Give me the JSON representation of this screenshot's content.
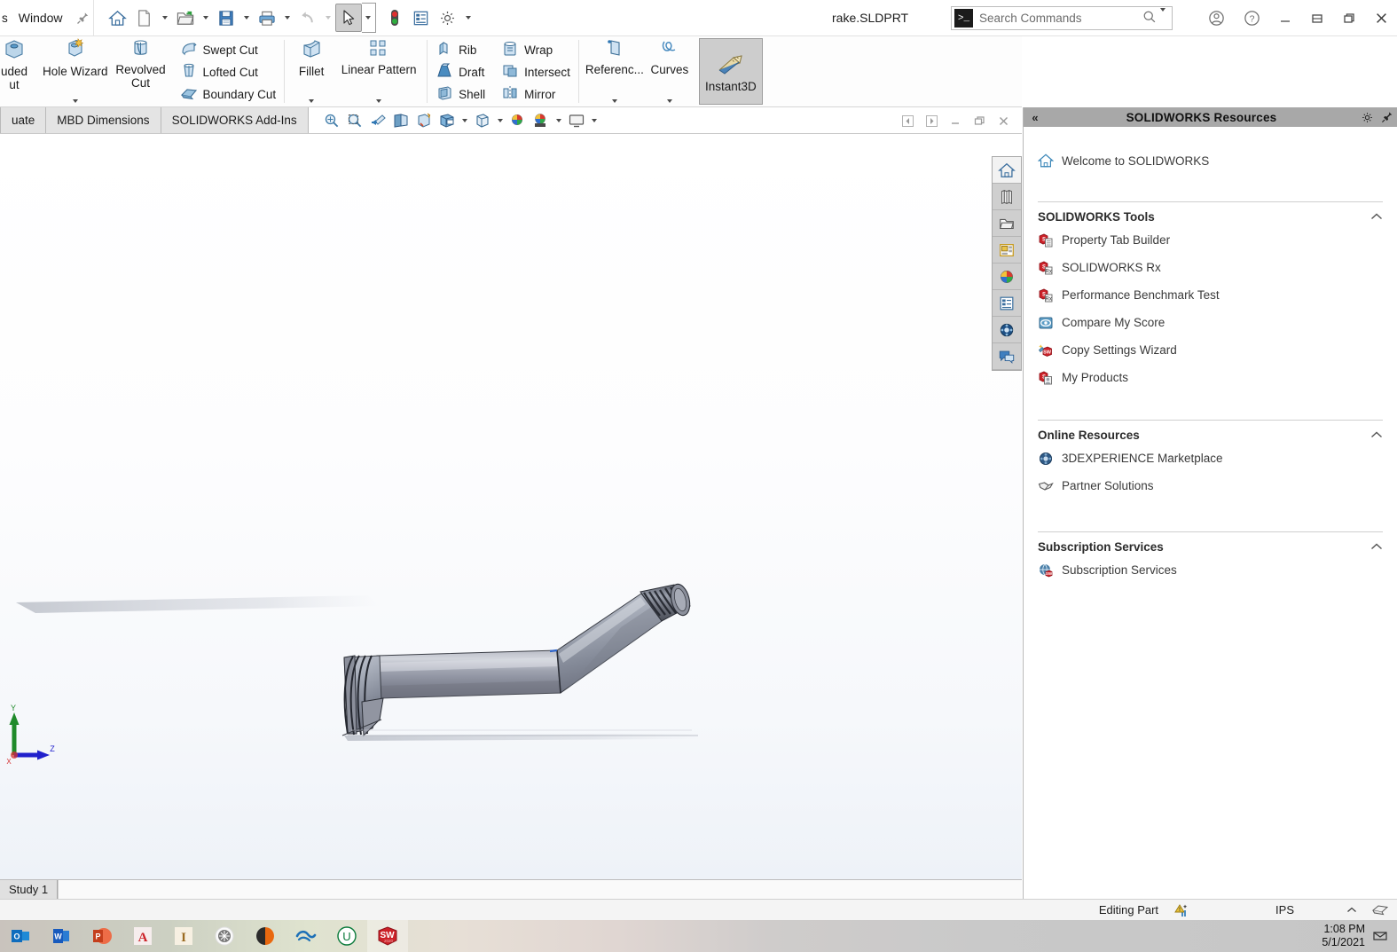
{
  "window": {
    "document_title": "rake.SLDPRT",
    "menu_partial": "s",
    "menu_window": "Window",
    "pin_icon": "pin-icon"
  },
  "search": {
    "placeholder": "Search Commands",
    "command_icon": "command-prompt-icon",
    "magnifier_icon": "search-icon",
    "dropdown_icon": "chevron-down-icon"
  },
  "titlebar_buttons": {
    "account": "account-icon",
    "help": "help-icon",
    "minimize": "minimize-icon",
    "restore": "restore-icon",
    "maximize": "maximize-icon",
    "close": "close-icon"
  },
  "quick_access": [
    {
      "name": "home-icon",
      "label": "Home",
      "has_dropdown": false
    },
    {
      "name": "new-document-icon",
      "label": "New",
      "has_dropdown": true
    },
    {
      "name": "open-folder-icon",
      "label": "Open",
      "has_dropdown": true
    },
    {
      "name": "save-icon",
      "label": "Save",
      "has_dropdown": true
    },
    {
      "name": "print-icon",
      "label": "Print",
      "has_dropdown": true
    },
    {
      "name": "undo-icon",
      "label": "Undo",
      "has_dropdown": true
    },
    {
      "name": "select-cursor-icon",
      "label": "Select",
      "has_dropdown": true
    },
    {
      "name": "rebuild-icon",
      "label": "Rebuild",
      "has_dropdown": false
    },
    {
      "name": "file-properties-icon",
      "label": "File Properties",
      "has_dropdown": false
    },
    {
      "name": "options-gear-icon",
      "label": "Options",
      "has_dropdown": true
    }
  ],
  "ribbon": {
    "groups": [
      {
        "type": "big",
        "items": [
          {
            "label": "uded\nut",
            "icon": "extruded-cut-icon",
            "dropdown": false
          },
          {
            "label": "Hole Wizard",
            "icon": "hole-wizard-icon",
            "dropdown": true
          },
          {
            "label": "Revolved\nCut",
            "icon": "revolved-cut-icon",
            "dropdown": false
          }
        ]
      },
      {
        "type": "small",
        "items": [
          {
            "label": "Swept Cut",
            "icon": "swept-cut-icon"
          },
          {
            "label": "Lofted Cut",
            "icon": "lofted-cut-icon"
          },
          {
            "label": "Boundary Cut",
            "icon": "boundary-cut-icon"
          }
        ]
      },
      {
        "type": "big",
        "items": [
          {
            "label": "Fillet",
            "icon": "fillet-icon",
            "dropdown": true
          },
          {
            "label": "Linear Pattern",
            "icon": "linear-pattern-icon",
            "dropdown": true
          }
        ]
      },
      {
        "type": "small",
        "items": [
          {
            "label": "Rib",
            "icon": "rib-icon"
          },
          {
            "label": "Draft",
            "icon": "draft-icon"
          },
          {
            "label": "Shell",
            "icon": "shell-icon"
          }
        ]
      },
      {
        "type": "small",
        "items": [
          {
            "label": "Wrap",
            "icon": "wrap-icon"
          },
          {
            "label": "Intersect",
            "icon": "intersect-icon"
          },
          {
            "label": "Mirror",
            "icon": "mirror-icon"
          }
        ]
      },
      {
        "type": "big",
        "items": [
          {
            "label": "Referenc...",
            "icon": "reference-geometry-icon",
            "dropdown": true
          },
          {
            "label": "Curves",
            "icon": "curves-icon",
            "dropdown": true
          }
        ]
      }
    ],
    "instant3d": {
      "label": "Instant3D",
      "icon": "instant3d-icon",
      "selected": true
    }
  },
  "command_tabs": [
    {
      "label": "uate",
      "active": false
    },
    {
      "label": "MBD Dimensions",
      "active": false
    },
    {
      "label": "SOLIDWORKS Add-Ins",
      "active": false
    }
  ],
  "view_tools": [
    {
      "name": "zoom-to-fit-icon",
      "label": "Zoom to Fit",
      "dropdown": false
    },
    {
      "name": "zoom-to-area-icon",
      "label": "Zoom to Area",
      "dropdown": false
    },
    {
      "name": "previous-view-icon",
      "label": "Previous View",
      "dropdown": false
    },
    {
      "name": "section-view-icon",
      "label": "Section View",
      "dropdown": false
    },
    {
      "name": "view-orientation-icon",
      "label": "View Orientation",
      "dropdown": false
    },
    {
      "name": "display-style-icon",
      "label": "Display Style",
      "dropdown": true
    },
    {
      "name": "hide-show-items-icon",
      "label": "Hide/Show Items",
      "dropdown": true
    },
    {
      "name": "edit-appearance-icon",
      "label": "Edit Appearance",
      "dropdown": true
    },
    {
      "name": "apply-scene-icon",
      "label": "Apply Scene",
      "dropdown": true
    },
    {
      "name": "view-settings-icon",
      "label": "View Settings",
      "dropdown": true
    }
  ],
  "viewport_window_controls": [
    {
      "name": "prev-pane-icon",
      "label": "Previous"
    },
    {
      "name": "next-pane-icon",
      "label": "Next"
    },
    {
      "name": "minimize-window-icon",
      "label": "Minimize"
    },
    {
      "name": "restore-window-icon",
      "label": "Restore"
    },
    {
      "name": "close-window-icon",
      "label": "Close"
    }
  ],
  "viewport_sidebar": [
    {
      "name": "solidworks-resources-icon",
      "label": "SOLIDWORKS Resources",
      "active": true
    },
    {
      "name": "design-library-icon",
      "label": "Design Library",
      "active": false
    },
    {
      "name": "file-explorer-icon",
      "label": "File Explorer",
      "active": false
    },
    {
      "name": "view-palette-icon",
      "label": "View Palette",
      "active": false
    },
    {
      "name": "appearances-scenes-icon",
      "label": "Appearances, Scenes and Decals",
      "active": false
    },
    {
      "name": "custom-properties-icon",
      "label": "Custom Properties",
      "active": false
    },
    {
      "name": "3dexperience-marketplace-icon",
      "label": "3DEXPERIENCE Marketplace",
      "active": false
    },
    {
      "name": "solidworks-forum-icon",
      "label": "SOLIDWORKS Forum",
      "active": false
    }
  ],
  "triad": {
    "x_label": "X",
    "y_label": "Y",
    "z_label": "Z",
    "x_color": "#d43030",
    "y_color": "#1f8a2a",
    "z_color": "#2020cc"
  },
  "study_bar": {
    "tab_label": "Study 1"
  },
  "task_pane": {
    "title": "SOLIDWORKS Resources",
    "collapse_icon": "chevron-double-left-icon",
    "gear_icon": "gear-icon",
    "pin_icon": "pin-icon",
    "welcome": {
      "label": "Welcome to SOLIDWORKS",
      "icon": "home-icon"
    },
    "sections": [
      {
        "title": "SOLIDWORKS Tools",
        "chevron": "chevron-up-icon",
        "links": [
          {
            "label": "Property Tab Builder",
            "icon": "sw-property-tab-icon"
          },
          {
            "label": "SOLIDWORKS Rx",
            "icon": "sw-rx-icon"
          },
          {
            "label": "Performance Benchmark Test",
            "icon": "sw-benchmark-icon"
          },
          {
            "label": "Compare My Score",
            "icon": "compare-score-icon"
          },
          {
            "label": "Copy Settings Wizard",
            "icon": "copy-settings-icon"
          },
          {
            "label": "My Products",
            "icon": "my-products-icon"
          }
        ]
      },
      {
        "title": "Online Resources",
        "chevron": "chevron-up-icon",
        "links": [
          {
            "label": "3DEXPERIENCE Marketplace",
            "icon": "3dexperience-icon"
          },
          {
            "label": "Partner Solutions",
            "icon": "partner-solutions-icon"
          }
        ]
      },
      {
        "title": "Subscription Services",
        "chevron": "chevron-up-icon",
        "links": [
          {
            "label": "Subscription Services",
            "icon": "subscription-globe-icon"
          }
        ]
      }
    ]
  },
  "status_bar": {
    "editing_state": "Editing Part",
    "units": "IPS",
    "overlay_icon": "overdefined-warning-icon",
    "units_caret": "chevron-up-icon",
    "tile_icon": "tile-windows-icon"
  },
  "taskbar": {
    "apps": [
      {
        "name": "outlook-icon",
        "label": "Outlook",
        "active": false
      },
      {
        "name": "word-icon",
        "label": "Word",
        "active": false
      },
      {
        "name": "powerpoint-icon",
        "label": "PowerPoint",
        "active": false
      },
      {
        "name": "autodesk-icon",
        "label": "Autodesk",
        "active": false
      },
      {
        "name": "inventor-icon",
        "label": "Inventor",
        "active": false
      },
      {
        "name": "meshmixer-icon",
        "label": "Meshmixer",
        "active": false
      },
      {
        "name": "cura-icon",
        "label": "Cura",
        "active": false
      },
      {
        "name": "onshape-icon",
        "label": "Onshape",
        "active": false
      },
      {
        "name": "unity-icon",
        "label": "Unity",
        "active": false
      },
      {
        "name": "solidworks-icon",
        "label": "SOLIDWORKS",
        "active": true
      }
    ],
    "clock_time": "1:08 PM",
    "clock_date": "5/1/2021",
    "notification_icon": "notifications-icon"
  }
}
